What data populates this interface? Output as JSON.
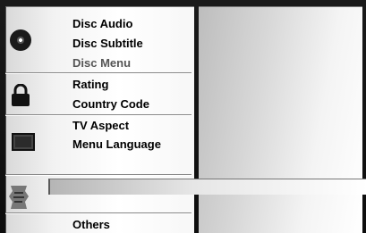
{
  "menu": {
    "disc_group": {
      "icon": "disc-icon",
      "items": [
        "Disc Audio",
        "Disc Subtitle",
        "Disc Menu"
      ]
    },
    "lock_group": {
      "icon": "lock-icon",
      "items": [
        "Rating",
        "Country Code"
      ]
    },
    "tv_group": {
      "icon": "tv-icon",
      "items": [
        "TV Aspect",
        "Menu Language"
      ]
    },
    "misc_group": {
      "icon": "misc-icon"
    },
    "others_label": "Others"
  }
}
